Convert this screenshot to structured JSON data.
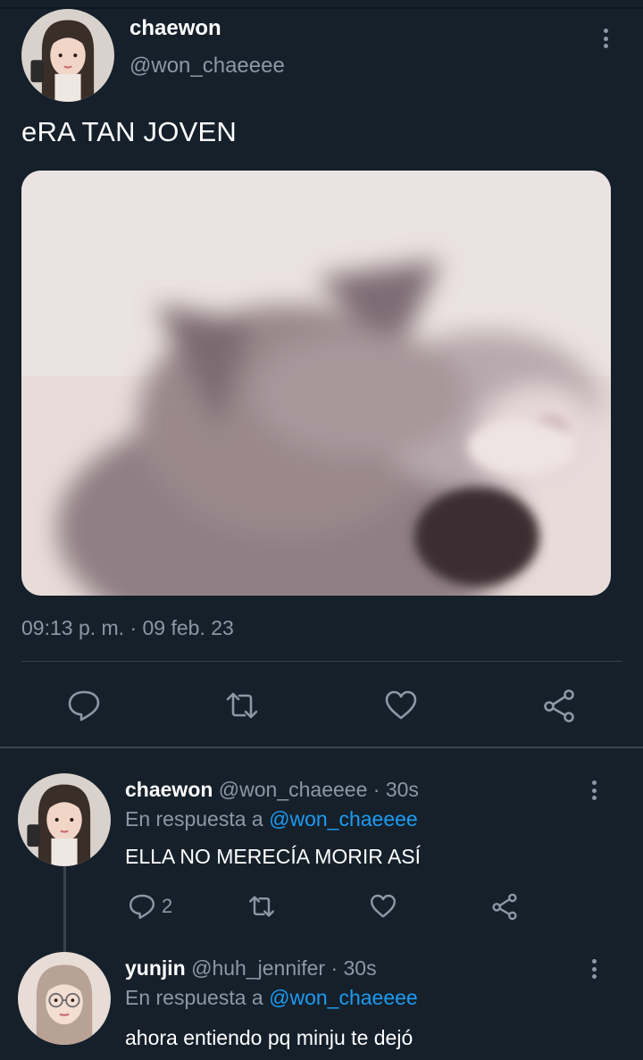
{
  "main_tweet": {
    "display_name": "chaewon",
    "handle": "@won_chaeeee",
    "text": "eRA TAN JOVEN",
    "timestamp": "09:13 p. m. · 09 feb. 23",
    "actions": [
      "reply-icon",
      "retweet-icon",
      "like-icon",
      "share-icon"
    ]
  },
  "replies": [
    {
      "display_name": "chaewon",
      "meta": " @won_chaeeee · 30s",
      "replying_prefix": "En respuesta a ",
      "replying_to": "@won_chaeeee",
      "text": "ELLA NO MERECÍA MORIR ASÍ",
      "reply_count": "2"
    },
    {
      "display_name": "yunjin",
      "meta": " @huh_jennifer · 30s",
      "replying_prefix": "En respuesta a ",
      "replying_to": "@won_chaeeee",
      "text": "ahora entiendo pq minju te dejó"
    }
  ],
  "colors": {
    "background": "#15202b",
    "secondary_text": "#8b98a5",
    "link": "#1d9bf0",
    "divider": "#38444d"
  }
}
